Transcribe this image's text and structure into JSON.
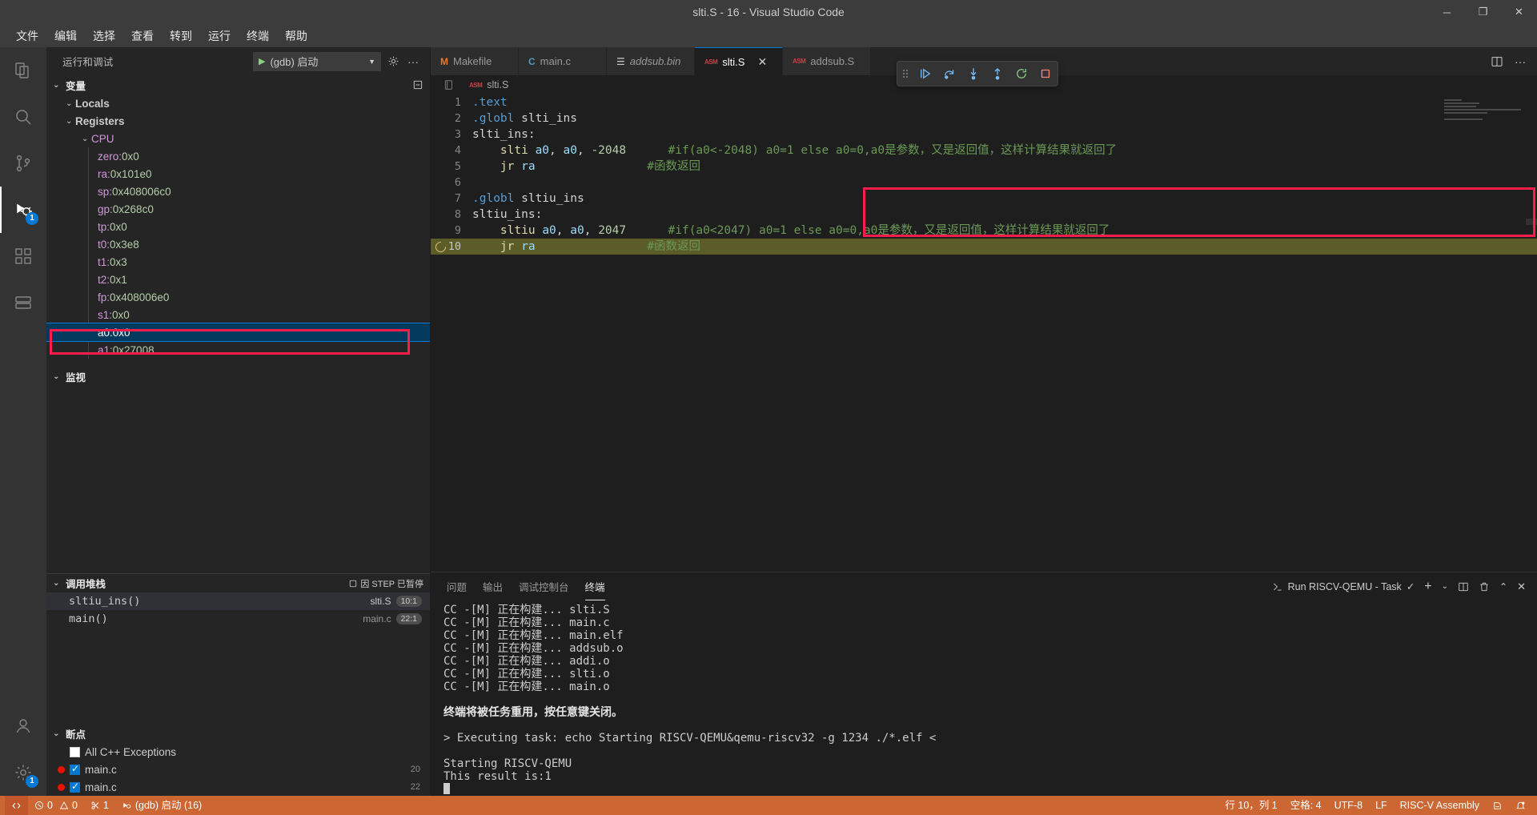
{
  "window": {
    "title": "slti.S - 16 - Visual Studio Code",
    "minimize": "─",
    "maximize": "❐",
    "close": "✕"
  },
  "menubar": [
    "文件",
    "编辑",
    "选择",
    "查看",
    "转到",
    "运行",
    "终端",
    "帮助"
  ],
  "activitybar": {
    "items": [
      {
        "name": "explorer-icon",
        "badge": ""
      },
      {
        "name": "search-icon",
        "badge": ""
      },
      {
        "name": "source-control-icon",
        "badge": ""
      },
      {
        "name": "run-and-debug-icon",
        "badge": "1"
      },
      {
        "name": "extensions-icon",
        "badge": ""
      },
      {
        "name": "remote-explorer-icon",
        "badge": ""
      }
    ],
    "bottom": [
      {
        "name": "accounts-icon",
        "badge": ""
      },
      {
        "name": "settings-gear-icon",
        "badge": "1"
      }
    ]
  },
  "sidebar": {
    "header_title": "运行和调试",
    "debug_config": "(gdb) 启动",
    "more_actions": "···",
    "variables": {
      "label": "变量",
      "groups": [
        {
          "label": "Locals",
          "items": []
        },
        {
          "label": "Registers",
          "items": [
            {
              "label": "CPU",
              "type": "group"
            }
          ]
        }
      ],
      "registers": [
        {
          "name": "zero",
          "value": "0x0",
          "selected": false
        },
        {
          "name": "ra",
          "value": "0x101e0",
          "selected": false
        },
        {
          "name": "sp",
          "value": "0x408006c0",
          "selected": false
        },
        {
          "name": "gp",
          "value": "0x268c0",
          "selected": false
        },
        {
          "name": "tp",
          "value": "0x0",
          "selected": false
        },
        {
          "name": "t0",
          "value": "0x3e8",
          "selected": false
        },
        {
          "name": "t1",
          "value": "0x3",
          "selected": false
        },
        {
          "name": "t2",
          "value": "0x1",
          "selected": false
        },
        {
          "name": "fp",
          "value": "0x408006e0",
          "selected": false
        },
        {
          "name": "s1",
          "value": "0x0",
          "selected": false
        },
        {
          "name": "a0",
          "value": "0x0",
          "selected": true
        },
        {
          "name": "a1",
          "value": "0x27008",
          "selected": false
        }
      ]
    },
    "watch": {
      "label": "监视"
    },
    "callstack": {
      "label": "调用堆栈",
      "status": "因 STEP 已暂停",
      "frames": [
        {
          "func": "sltiu_ins()",
          "file": "slti.S",
          "pos": "10:1",
          "focused": true
        },
        {
          "func": "main()",
          "file": "main.c",
          "pos": "22:1",
          "focused": false
        }
      ]
    },
    "breakpoints": {
      "label": "断点",
      "items": [
        {
          "label": "All C++ Exceptions",
          "checked": false,
          "has_dot": false,
          "line": ""
        },
        {
          "label": "main.c",
          "checked": true,
          "has_dot": true,
          "line": "20"
        },
        {
          "label": "main.c",
          "checked": true,
          "has_dot": true,
          "line": "22"
        }
      ]
    }
  },
  "tabs": [
    {
      "label": "Makefile",
      "icon": "M",
      "icon_kind": "m",
      "active": false,
      "italic": false
    },
    {
      "label": "main.c",
      "icon": "C",
      "icon_kind": "c",
      "active": false,
      "italic": false
    },
    {
      "label": "addsub.bin",
      "icon": "☰",
      "icon_kind": "bin",
      "active": false,
      "italic": true
    },
    {
      "label": "slti.S",
      "icon": "ASM",
      "icon_kind": "asm",
      "active": true,
      "italic": false
    },
    {
      "label": "addsub.S",
      "icon": "ASM",
      "icon_kind": "asm",
      "active": false,
      "italic": false
    }
  ],
  "editor_actions": {
    "split_editor": "split-editor-icon",
    "more": "···"
  },
  "debug_toolbar": [
    {
      "name": "drag-handle-icon",
      "title": "拖动"
    },
    {
      "name": "continue-icon",
      "title": "继续"
    },
    {
      "name": "step-over-icon",
      "title": "单步跳过"
    },
    {
      "name": "step-into-icon",
      "title": "单步调试"
    },
    {
      "name": "step-out-icon",
      "title": "单步跳出"
    },
    {
      "name": "restart-icon",
      "title": "重启"
    },
    {
      "name": "stop-icon",
      "title": "停止"
    }
  ],
  "breadcrumb": {
    "file": "slti.S"
  },
  "code": {
    "language": "RISC-V Assembly",
    "current_line": 10,
    "lines": [
      {
        "n": 1,
        "tokens": [
          {
            "t": ".text",
            "c": "dir"
          }
        ]
      },
      {
        "n": 2,
        "tokens": [
          {
            "t": ".globl ",
            "c": "dir"
          },
          {
            "t": "slti_ins",
            "c": "lbl"
          }
        ]
      },
      {
        "n": 3,
        "tokens": [
          {
            "t": "slti_ins:",
            "c": "lbl"
          }
        ]
      },
      {
        "n": 4,
        "tokens": [
          {
            "t": "    ",
            "c": "pun"
          },
          {
            "t": "slti",
            "c": "ins"
          },
          {
            "t": " ",
            "c": "pun"
          },
          {
            "t": "a0",
            "c": "reg"
          },
          {
            "t": ", ",
            "c": "pun"
          },
          {
            "t": "a0",
            "c": "reg"
          },
          {
            "t": ", ",
            "c": "pun"
          },
          {
            "t": "-2048",
            "c": "num"
          },
          {
            "t": "      ",
            "c": "pun"
          },
          {
            "t": "#if(a0<-2048) a0=1 else a0=0,a0是参数，又是返回值，这样计算结果就返回了",
            "c": "cmt"
          }
        ]
      },
      {
        "n": 5,
        "tokens": [
          {
            "t": "    ",
            "c": "pun"
          },
          {
            "t": "jr",
            "c": "ins"
          },
          {
            "t": " ",
            "c": "pun"
          },
          {
            "t": "ra",
            "c": "reg"
          },
          {
            "t": "                ",
            "c": "pun"
          },
          {
            "t": "#函数返回",
            "c": "cmt"
          }
        ]
      },
      {
        "n": 6,
        "tokens": []
      },
      {
        "n": 7,
        "tokens": [
          {
            "t": ".globl ",
            "c": "dir"
          },
          {
            "t": "sltiu_ins",
            "c": "lbl"
          }
        ]
      },
      {
        "n": 8,
        "tokens": [
          {
            "t": "sltiu_ins:",
            "c": "lbl"
          }
        ]
      },
      {
        "n": 9,
        "tokens": [
          {
            "t": "    ",
            "c": "pun"
          },
          {
            "t": "sltiu",
            "c": "ins"
          },
          {
            "t": " ",
            "c": "pun"
          },
          {
            "t": "a0",
            "c": "reg"
          },
          {
            "t": ", ",
            "c": "pun"
          },
          {
            "t": "a0",
            "c": "reg"
          },
          {
            "t": ", ",
            "c": "pun"
          },
          {
            "t": "2047",
            "c": "num"
          },
          {
            "t": "      ",
            "c": "pun"
          },
          {
            "t": "#if(a0<2047) a0=1 else a0=0,a0是参数，又是返回值，这样计算结果就返回了",
            "c": "cmt"
          }
        ]
      },
      {
        "n": 10,
        "tokens": [
          {
            "t": "    ",
            "c": "pun"
          },
          {
            "t": "jr",
            "c": "ins"
          },
          {
            "t": " ",
            "c": "pun"
          },
          {
            "t": "ra",
            "c": "reg"
          },
          {
            "t": "                ",
            "c": "pun"
          },
          {
            "t": "#函数返回",
            "c": "cmt"
          }
        ]
      }
    ]
  },
  "panel": {
    "tabs": [
      {
        "label": "问题",
        "active": false
      },
      {
        "label": "输出",
        "active": false
      },
      {
        "label": "调试控制台",
        "active": false
      },
      {
        "label": "终端",
        "active": true
      }
    ],
    "task_label": "Run RISCV-QEMU - Task",
    "actions": {
      "check": "✓",
      "add": "+",
      "split": "split-terminal-icon",
      "kill": "trash-icon",
      "chevron": "⌄",
      "close": "✕"
    },
    "terminal_lines": [
      {
        "text": "CC -[M] 正在构建... slti.S",
        "bold": false
      },
      {
        "text": "CC -[M] 正在构建... main.c",
        "bold": false
      },
      {
        "text": "CC -[M] 正在构建... main.elf",
        "bold": false
      },
      {
        "text": "CC -[M] 正在构建... addsub.o",
        "bold": false
      },
      {
        "text": "CC -[M] 正在构建... addi.o",
        "bold": false
      },
      {
        "text": "CC -[M] 正在构建... slti.o",
        "bold": false
      },
      {
        "text": "CC -[M] 正在构建... main.o",
        "bold": false
      },
      {
        "text": "",
        "bold": false
      },
      {
        "text": "终端将被任务重用，按任意键关闭。",
        "bold": true
      },
      {
        "text": "",
        "bold": false
      },
      {
        "text": "> Executing task: echo Starting RISCV-QEMU&qemu-riscv32 -g 1234 ./*.elf <",
        "bold": false
      },
      {
        "text": "",
        "bold": false
      },
      {
        "text": "Starting RISCV-QEMU",
        "bold": false
      },
      {
        "text": "This result is:1",
        "bold": false
      }
    ]
  },
  "statusbar": {
    "remote_icon": "remote-window-icon",
    "errors": "0",
    "warnings": "0",
    "ports": "1",
    "debug_session": "(gdb) 启动 (16)",
    "position": "行 10，列 1",
    "spaces": "空格: 4",
    "encoding": "UTF-8",
    "eol": "LF",
    "language": "RISC-V Assembly",
    "feedback": "smiley-icon",
    "bell": "bell-icon"
  },
  "colors": {
    "accent": "#0078d4",
    "status_bar": "#cc6633",
    "annotation": "#fb1d4a",
    "selection": "#04395e",
    "current_line": "#5c5c28"
  }
}
